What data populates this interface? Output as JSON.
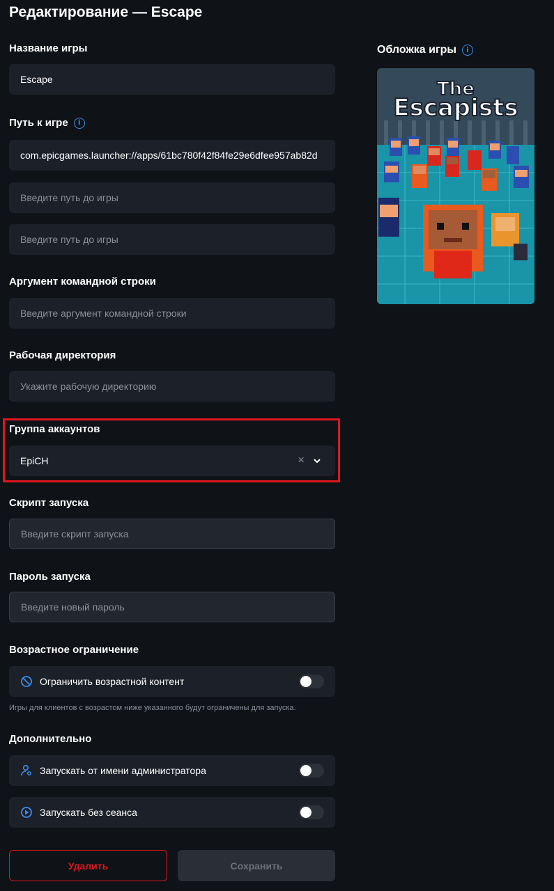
{
  "page": {
    "title": "Редактирование — Escape"
  },
  "game_name": {
    "label": "Название игры",
    "value": "Escape"
  },
  "game_path": {
    "label": "Путь к игре",
    "value": "com.epicgames.launcher://apps/61bc780f42f84fe29e6dfee957ab82d",
    "placeholder_1": "Введите путь до игры",
    "placeholder_2": "Введите путь до игры"
  },
  "args": {
    "label": "Аргумент командной строки",
    "placeholder": "Введите аргумент командной строки"
  },
  "workdir": {
    "label": "Рабочая директория",
    "placeholder": "Укажите рабочую директорию"
  },
  "account_group": {
    "label": "Группа аккаунтов",
    "value": "EpiCH",
    "clear": "×"
  },
  "launch_script": {
    "label": "Скрипт запуска",
    "placeholder": "Введите скрипт запуска"
  },
  "launch_password": {
    "label": "Пароль запуска",
    "placeholder": "Введите новый пароль"
  },
  "age": {
    "label": "Возрастное ограничение",
    "option": "Ограничить возрастной контент",
    "enabled": false,
    "hint": "Игры для клиентов с возрастом ниже указанного  будут ограничены для запуска."
  },
  "extra": {
    "label": "Дополнительно",
    "run_as_admin": {
      "text": "Запускать от имени администратора",
      "enabled": false
    },
    "run_without_session": {
      "text": "Запускать без сеанса",
      "enabled": false
    }
  },
  "cover": {
    "label": "Обложка игры",
    "art_title_1": "The",
    "art_title_2": "Escapists"
  },
  "buttons": {
    "delete": "Удалить",
    "save": "Сохранить"
  },
  "colors": {
    "accent_blue": "#3d8cf0",
    "danger_red": "#e0161e",
    "background": "#0f1216",
    "field": "#1c2028"
  }
}
